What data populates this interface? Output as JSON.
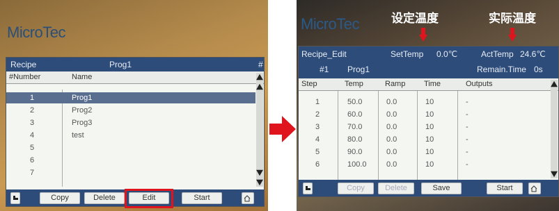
{
  "left_panel": {
    "brand": "MicroTec",
    "topbar": {
      "label": "Recipe",
      "value": "Prog1",
      "hash": "#"
    },
    "columns": [
      "#Number",
      "Name"
    ],
    "rows": [
      {
        "num": "1",
        "name": "Prog1",
        "selected": true
      },
      {
        "num": "2",
        "name": "Prog2",
        "selected": false
      },
      {
        "num": "3",
        "name": "Prog3",
        "selected": false
      },
      {
        "num": "4",
        "name": "test",
        "selected": false
      },
      {
        "num": "5",
        "name": "",
        "selected": false
      },
      {
        "num": "6",
        "name": "",
        "selected": false
      },
      {
        "num": "7",
        "name": "",
        "selected": false
      }
    ],
    "buttons": {
      "copy": "Copy",
      "delete": "Delete",
      "edit": "Edit",
      "start": "Start"
    }
  },
  "right_panel": {
    "brand": "MicroTec",
    "annotations": {
      "set_temp": "设定温度",
      "actual_temp": "实际温度"
    },
    "topbar": {
      "title": "Recipe_Edit",
      "settemp_label": "SetTemp",
      "settemp_value": "0.0℃",
      "acttemp_label": "ActTemp",
      "acttemp_value": "24.6℃",
      "number": "#1",
      "program": "Prog1",
      "remain_label": "Remain.Time",
      "remain_value": "0s"
    },
    "columns": [
      "Step",
      "Temp",
      "Ramp",
      "Time",
      "Outputs"
    ],
    "rows": [
      {
        "step": "1",
        "temp": "50.0",
        "ramp": "0.0",
        "time": "10",
        "outputs": "-"
      },
      {
        "step": "2",
        "temp": "60.0",
        "ramp": "0.0",
        "time": "10",
        "outputs": "-"
      },
      {
        "step": "3",
        "temp": "70.0",
        "ramp": "0.0",
        "time": "10",
        "outputs": "-"
      },
      {
        "step": "4",
        "temp": "80.0",
        "ramp": "0.0",
        "time": "10",
        "outputs": "-"
      },
      {
        "step": "5",
        "temp": "90.0",
        "ramp": "0.0",
        "time": "10",
        "outputs": "-"
      },
      {
        "step": "6",
        "temp": "100.0",
        "ramp": "0.0",
        "time": "10",
        "outputs": "-"
      }
    ],
    "buttons": {
      "copy": "Copy",
      "delete": "Delete",
      "save": "Save",
      "start": "Start"
    }
  },
  "colors": {
    "highlight": "#e0141c",
    "topbar": "#2e4c7a",
    "arrow": "#e0141c"
  }
}
